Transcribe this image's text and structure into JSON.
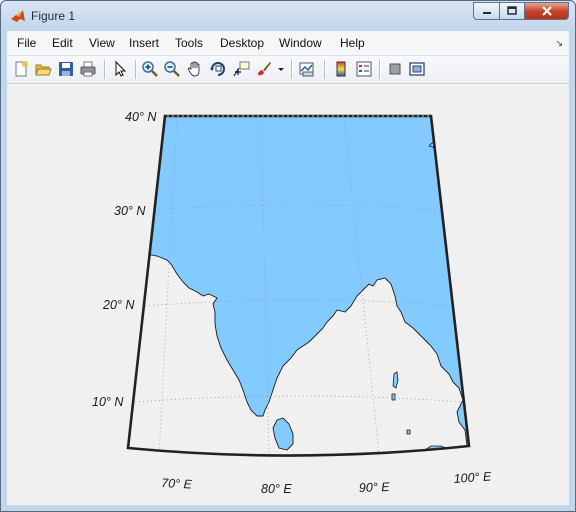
{
  "window": {
    "title": "Figure 1"
  },
  "menu": [
    "File",
    "Edit",
    "View",
    "Insert",
    "Tools",
    "Desktop",
    "Window",
    "Help"
  ],
  "toolbar": {
    "icons": [
      "new-figure-icon",
      "open-file-icon",
      "save-icon",
      "print-icon",
      "pointer-arrow-icon",
      "zoom-in-icon",
      "zoom-out-icon",
      "pan-hand-icon",
      "rotate-3d-icon",
      "data-cursor-icon",
      "brush-icon",
      "brush-dropdown-icon",
      "link-plot-icon",
      "insert-colorbar-icon",
      "insert-legend-icon",
      "hide-plot-tools-icon",
      "show-plot-tools-icon"
    ]
  },
  "map": {
    "land_color": "#82CAFF",
    "frame_color": "#222222",
    "latitude_labels": {
      "lat40": "40° N",
      "lat30": "30° N",
      "lat20": "20° N",
      "lat10": "10° N"
    },
    "longitude_labels": {
      "lon70": "70° E",
      "lon80": "80° E",
      "lon90": "90° E",
      "lon100": "100° E"
    }
  }
}
